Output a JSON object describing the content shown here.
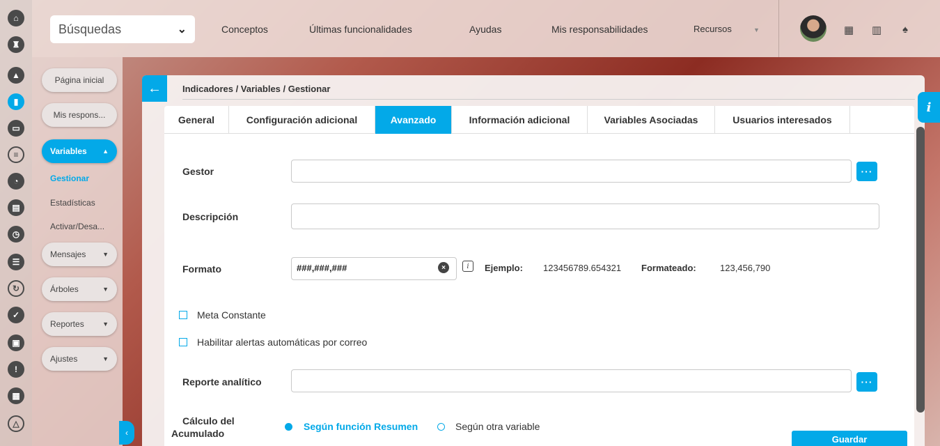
{
  "topbar": {
    "search_label": "Búsquedas",
    "nav": [
      "Conceptos",
      "Últimas funcionalidades",
      "Ayudas",
      "Mis responsabilidades",
      "Recursos"
    ],
    "icons": [
      "calendar-icon",
      "book-icon",
      "bell-icon"
    ]
  },
  "rail": {
    "icons": [
      "home-icon",
      "chess-rook-icon",
      "triangle-icon",
      "bar-chart-icon",
      "presentation-icon",
      "gantt-icon",
      "pie-chart-icon",
      "book-icon",
      "clock-icon",
      "list-icon",
      "refresh-icon",
      "check-icon",
      "briefcase-icon",
      "warning-icon",
      "calendar-icon",
      "network-icon"
    ]
  },
  "sidebar": {
    "home": "Página inicial",
    "resp": "Mis respons...",
    "variables": "Variables",
    "sub": [
      "Gestionar",
      "Estadísticas",
      "Activar/Desa..."
    ],
    "mensajes": "Mensajes",
    "arboles": "Árboles",
    "reportes": "Reportes",
    "ajustes": "Ajustes"
  },
  "breadcrumb": "Indicadores / Variables / Gestionar",
  "tabs": [
    "General",
    "Configuración adicional",
    "Avanzado",
    "Información adicional",
    "Variables Asociadas",
    "Usuarios interesados"
  ],
  "active_tab": "Avanzado",
  "form": {
    "gestor_label": "Gestor",
    "gestor_value": "",
    "descripcion_label": "Descripción",
    "descripcion_value": "",
    "formato_label": "Formato",
    "formato_value": "###,###,###",
    "ejemplo_label": "Ejemplo:",
    "ejemplo_value": "123456789.654321",
    "formateado_label": "Formateado:",
    "formateado_value": "123,456,790",
    "meta_constante": "Meta Constante",
    "meta_constante_checked": false,
    "alertas": "Habilitar alertas automáticas por correo",
    "alertas_checked": false,
    "reporte_label": "Reporte analítico",
    "reporte_value": "",
    "calculo_label_1": "Cálculo del",
    "calculo_label_2": "Acumulado",
    "radio_1": "Según función Resumen",
    "radio_2": "Según otra variable",
    "selected_radio": "Según función Resumen"
  },
  "save_label": "Guardar",
  "colors": {
    "accent": "#03a9e8"
  }
}
